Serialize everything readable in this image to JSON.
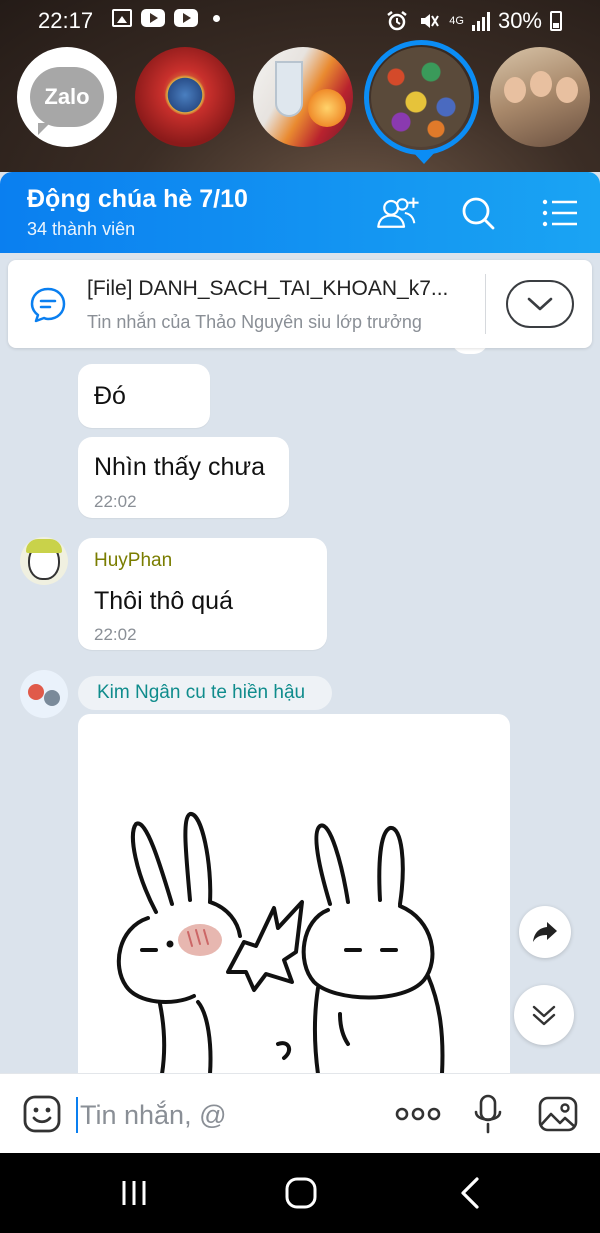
{
  "status_bar": {
    "time": "22:17",
    "network": "4G",
    "battery": "30%"
  },
  "stories": [
    {
      "name": "zalo-official",
      "label": "Zalo"
    },
    {
      "name": "soviet-emblem"
    },
    {
      "name": "drinks"
    },
    {
      "name": "colorful-doodle",
      "active": true
    },
    {
      "name": "soldiers"
    }
  ],
  "header": {
    "group_name": "Động chúa hè 7/10",
    "member_count": "34 thành viên",
    "accent_color": "#0a7ff0"
  },
  "pinned": {
    "title": "[File] DANH_SACH_TAI_KHOAN_k7...",
    "subtitle": "Tin nhắn của Thảo Nguyên siu lớp trưởng"
  },
  "messages": [
    {
      "text": "Đó"
    },
    {
      "text": "Nhìn thấy chưa",
      "time": "22:02"
    },
    {
      "sender": "HuyPhan",
      "sender_color": "#7a7d00",
      "text": "Thôi thô quá",
      "time": "22:02"
    },
    {
      "sender": "Kim Ngân cu te hiền hậu",
      "sender_color": "#0f8c8c",
      "attachment": "sticker-image"
    }
  ],
  "input": {
    "placeholder": "Tin nhắn, @"
  }
}
